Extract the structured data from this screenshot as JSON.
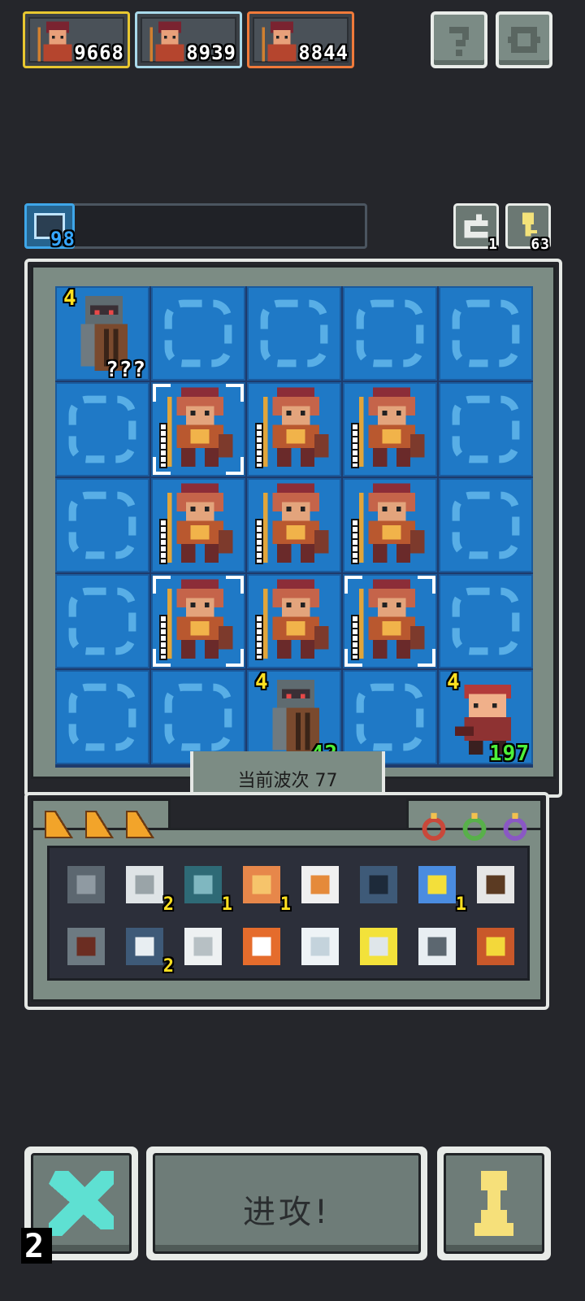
{
  "top_bar": {
    "heroes": [
      {
        "score": "9668",
        "border_color": "#e8c730"
      },
      {
        "score": "8939",
        "border_color": "#a9d9ea"
      },
      {
        "score": "8844",
        "border_color": "#f07a3a"
      }
    ],
    "help_icon": "question-mark-icon",
    "settings_icon": "gear-icon"
  },
  "status": {
    "mana": "98",
    "reroll_count": "1",
    "key_count": "63"
  },
  "board": {
    "wave_label": "当前波次 77",
    "cells": [
      {
        "unit": "knight",
        "level": "4",
        "count": "???"
      },
      {},
      {},
      {},
      {},
      {},
      {
        "unit": "warrior",
        "selected": true
      },
      {
        "unit": "warrior"
      },
      {
        "unit": "warrior"
      },
      {},
      {},
      {
        "unit": "warrior"
      },
      {
        "unit": "warrior"
      },
      {
        "unit": "warrior"
      },
      {},
      {},
      {
        "unit": "warrior",
        "selected": true
      },
      {
        "unit": "warrior"
      },
      {
        "unit": "warrior",
        "selected": true
      },
      {},
      {},
      {},
      {
        "unit": "knight",
        "level": "4",
        "count": "42"
      },
      {},
      {
        "unit": "brawler",
        "level": "4",
        "count": "197"
      }
    ]
  },
  "inventory": {
    "tabs": [
      "orange-triangle-icon",
      "orange-triangle-icon",
      "orange-triangle-icon"
    ],
    "rings": [
      "red-ring-icon",
      "green-ring-icon",
      "purple-ring-icon"
    ],
    "items": [
      {
        "name": "stone-block-icon",
        "count": ""
      },
      {
        "name": "scroll-icon",
        "count": "2"
      },
      {
        "name": "heart-gem-icon",
        "count": "1"
      },
      {
        "name": "bell-icon",
        "count": "1"
      },
      {
        "name": "feather-icon",
        "count": ""
      },
      {
        "name": "ore-icon",
        "count": ""
      },
      {
        "name": "crystal-icon",
        "count": "1"
      },
      {
        "name": "pickaxe-icon",
        "count": ""
      },
      {
        "name": "hammer-icon",
        "count": ""
      },
      {
        "name": "rubble-icon",
        "count": "2"
      },
      {
        "name": "parchment-icon",
        "count": ""
      },
      {
        "name": "tail-icon",
        "count": ""
      },
      {
        "name": "ice-spikes-icon",
        "count": ""
      },
      {
        "name": "double-axe-icon",
        "count": ""
      },
      {
        "name": "boot-icon",
        "count": ""
      },
      {
        "name": "treasure-chest-icon",
        "count": ""
      }
    ]
  },
  "controls": {
    "attack_label": "进攻!",
    "speed": "2",
    "cancel_icon": "cross-icon",
    "pawn_icon": "pawn-icon"
  }
}
